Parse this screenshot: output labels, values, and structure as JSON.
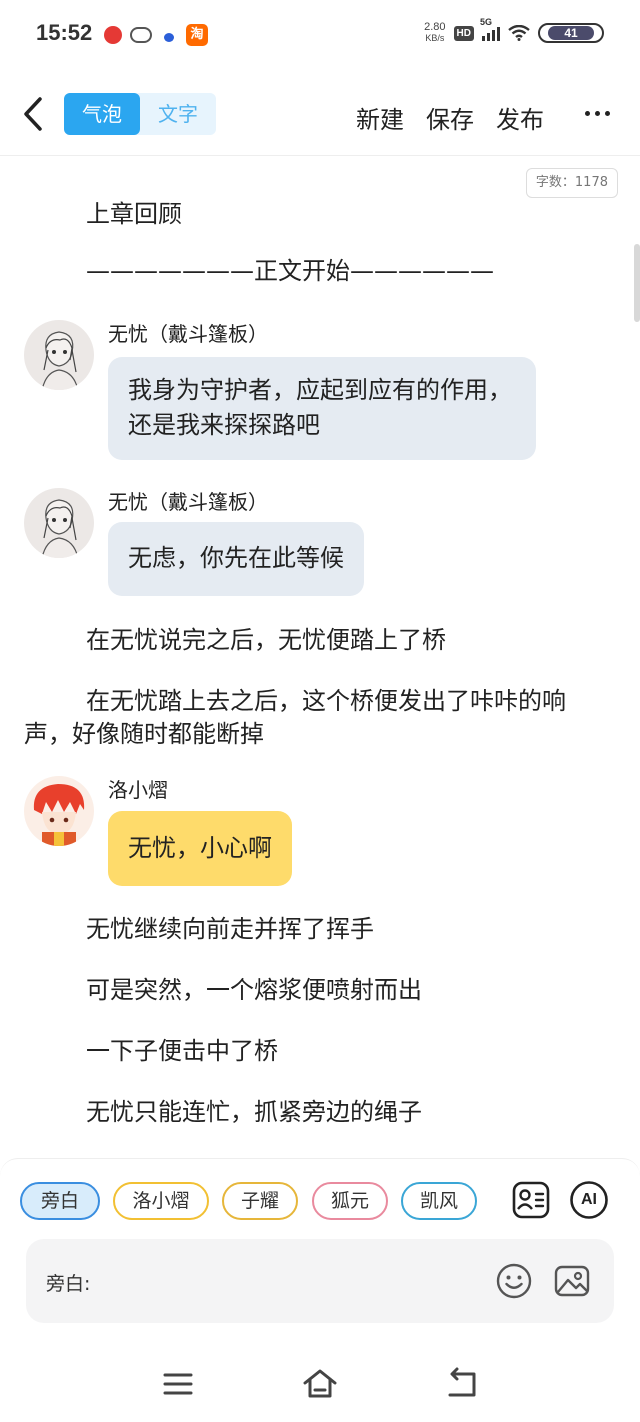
{
  "status_bar": {
    "time": "15:52",
    "net_speed_value": "2.80",
    "net_speed_unit": "KB/s",
    "hd": "HD",
    "network": "5G",
    "battery": "41",
    "taobao_glyph": "淘"
  },
  "header": {
    "mode_tabs": [
      "气泡",
      "文字"
    ],
    "active_mode": "气泡",
    "actions": [
      "新建",
      "保存",
      "发布"
    ]
  },
  "word_count": "字数：1178",
  "content": {
    "recap": "上章回顾",
    "divider": "———————正文开始——————",
    "messages": [
      {
        "speaker": "无忧（戴斗篷板）",
        "text": "我身为守护者，应起到应有的作用，还是我来探探路吧",
        "color": "#e5ebf2"
      },
      {
        "speaker": "无忧（戴斗篷板）",
        "text": "无虑，你先在此等候",
        "color": "#e5ebf2"
      },
      {
        "speaker": "洛小熠",
        "text": "无忧，小心啊",
        "color": "#fedb6b"
      }
    ],
    "paragraphs": [
      "在无忧说完之后，无忧便踏上了桥",
      "在无忧踏上去之后，这个桥便发出了咔咔的响声，好像随时都能断掉",
      "无忧继续向前走并挥了挥手",
      "可是突然，一个熔浆便喷射而出",
      "一下子便击中了桥",
      "无忧只能连忙，抓紧旁边的绳子"
    ]
  },
  "composer": {
    "roles": [
      "旁白",
      "洛小熠",
      "子耀",
      "狐元",
      "凯风"
    ],
    "selected_role": "旁白",
    "ai_label": "AI",
    "input_label": "旁白:",
    "input_value": "",
    "input_placeholder": ""
  },
  "colors": {
    "accent": "#2ba6f0",
    "bubble_gray": "#e5ebf2",
    "bubble_yellow": "#fedb6b"
  },
  "icons": [
    "back-arrow-icon",
    "more-icon",
    "role-card-icon",
    "ai-icon",
    "emoji-icon",
    "image-icon",
    "menu-icon",
    "home-icon",
    "back-icon"
  ]
}
